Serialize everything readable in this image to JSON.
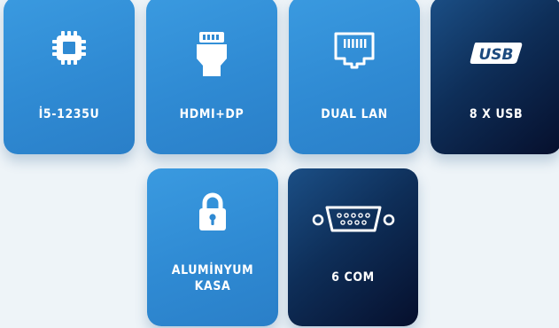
{
  "cards": [
    {
      "label": "İ5-1235U",
      "icon": "cpu-icon",
      "style": "blue"
    },
    {
      "label": "HDMI+DP",
      "icon": "hdmi-icon",
      "style": "blue"
    },
    {
      "label": "DUAL LAN",
      "icon": "ethernet-port-icon",
      "style": "blue"
    },
    {
      "label": "8 X USB",
      "icon": "usb-logo-icon",
      "style": "dark",
      "logo_text": "USB"
    },
    {
      "label_line1": "ALUMİNYUM",
      "label_line2": "KASA",
      "icon": "padlock-icon",
      "style": "blue"
    },
    {
      "label": "6 COM",
      "icon": "serial-port-icon",
      "style": "dark"
    }
  ],
  "colors": {
    "background": "#eef4f8",
    "card_blue": "#2f8ad3",
    "card_dark": "#0a1a3c",
    "text": "#ffffff"
  }
}
